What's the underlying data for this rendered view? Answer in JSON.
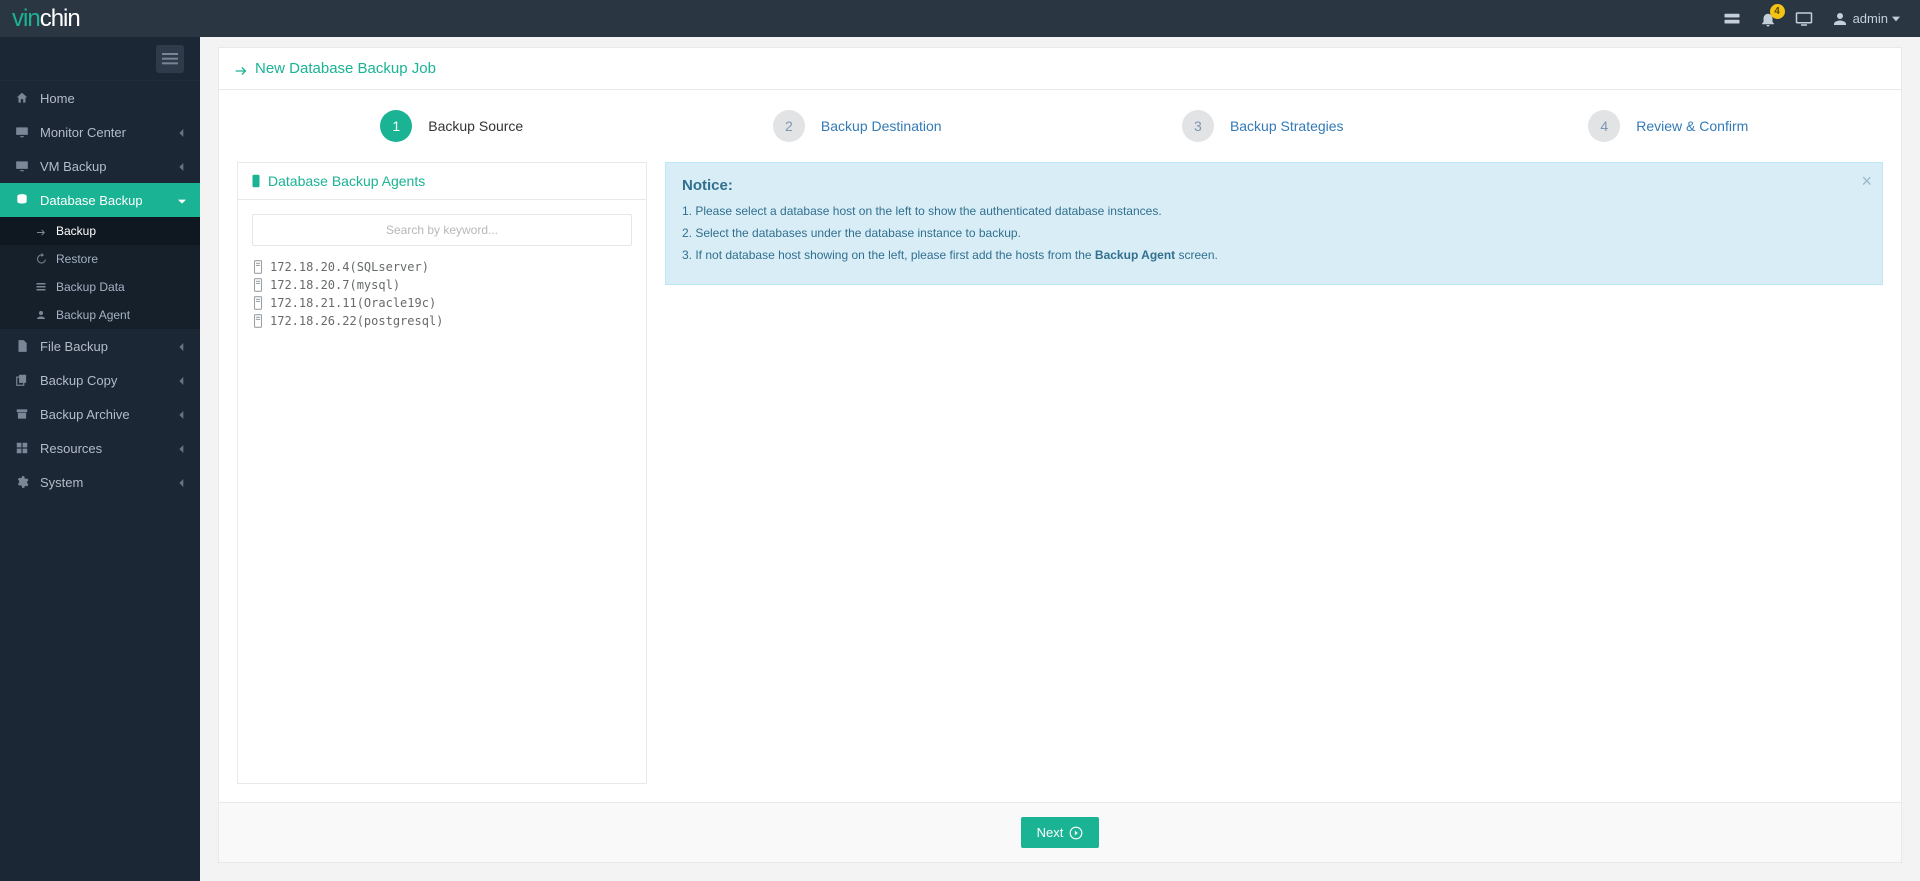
{
  "header": {
    "logo_prefix": "vin",
    "logo_suffix": "chin",
    "notification_count": "4",
    "user_label": "admin"
  },
  "sidebar": {
    "items": [
      {
        "label": "Home",
        "has_children": false
      },
      {
        "label": "Monitor Center",
        "has_children": true
      },
      {
        "label": "VM Backup",
        "has_children": true
      },
      {
        "label": "Database Backup",
        "has_children": true,
        "active": true
      },
      {
        "label": "File Backup",
        "has_children": true
      },
      {
        "label": "Backup Copy",
        "has_children": true
      },
      {
        "label": "Backup Archive",
        "has_children": true
      },
      {
        "label": "Resources",
        "has_children": true
      },
      {
        "label": "System",
        "has_children": true
      }
    ],
    "subitems": [
      {
        "label": "Backup",
        "active": true
      },
      {
        "label": "Restore"
      },
      {
        "label": "Backup Data"
      },
      {
        "label": "Backup Agent"
      }
    ]
  },
  "page": {
    "title": "New Database Backup Job"
  },
  "wizard": [
    {
      "num": "1",
      "label": "Backup Source",
      "state": "active"
    },
    {
      "num": "2",
      "label": "Backup Destination",
      "state": "pending"
    },
    {
      "num": "3",
      "label": "Backup Strategies",
      "state": "pending"
    },
    {
      "num": "4",
      "label": "Review & Confirm",
      "state": "pending"
    }
  ],
  "agents_panel": {
    "title": "Database Backup Agents",
    "search_placeholder": "Search by keyword...",
    "agents": [
      "172.18.20.4(SQLserver)",
      "172.18.20.7(mysql)",
      "172.18.21.11(Oracle19c)",
      "172.18.26.22(postgresql)"
    ]
  },
  "notice": {
    "title": "Notice:",
    "lines": [
      {
        "pre": "1. Please select a database host on the left to show the authenticated database instances.",
        "bold": "",
        "post": ""
      },
      {
        "pre": "2. Select the databases under the database instance to backup.",
        "bold": "",
        "post": ""
      },
      {
        "pre": "3. If not database host showing on the left, please first add the hosts from the ",
        "bold": "Backup Agent",
        "post": " screen."
      }
    ]
  },
  "footer": {
    "next_label": "Next"
  }
}
